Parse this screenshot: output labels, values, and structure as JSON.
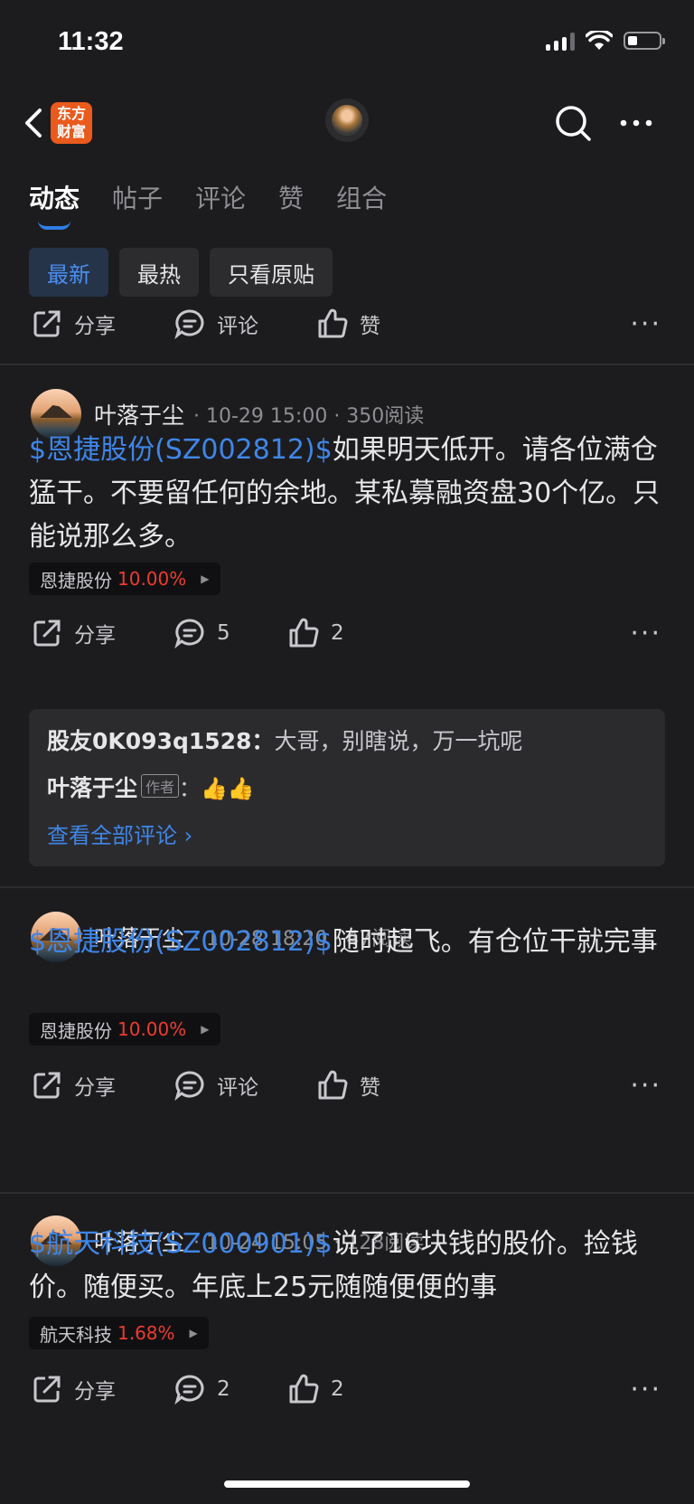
{
  "status": {
    "time": "11:32"
  },
  "nav": {
    "logo_line1": "东方",
    "logo_line2": "财富"
  },
  "tabs": [
    "动态",
    "帖子",
    "评论",
    "赞",
    "组合"
  ],
  "filters": [
    "最新",
    "最热",
    "只看原贴"
  ],
  "labels": {
    "share": "分享",
    "comment": "评论",
    "like": "赞",
    "more": "···"
  },
  "posts": [
    {
      "author": "叶落于尘",
      "meta": "· 10-29 15:00 · 350阅读",
      "tag": "$恩捷股份(SZ002812)$",
      "text": "如果明天低开。请各位满仓猛干。不要留任何的余地。某私募融资盘30个亿。只能说那么多。",
      "stock": "恩捷股份",
      "pct": "10.00%",
      "comment_count": "5",
      "like_count": "2"
    },
    {
      "author": "叶落于尘",
      "meta": "· 10-28 18:20 · 47阅读",
      "tag": "$恩捷股份(SZ002812)$",
      "text": "随时起飞。有仓位干就完事",
      "stock": "恩捷股份",
      "pct": "10.00%",
      "comment_count": "评论",
      "like_count": "赞"
    },
    {
      "author": "叶落于尘",
      "meta": "· 10-24 15:05 · 128阅读",
      "tag": "$航天科技(SZ000901)$",
      "text": "说了16块钱的股价。捡钱价。随便买。年底上25元随随便便的事",
      "stock": "航天科技",
      "pct": "1.68%",
      "comment_count": "2",
      "like_count": "2"
    }
  ],
  "comments": {
    "c1_user": "股友0K093q1528：",
    "c1_text": "大哥，别瞎说，万一坑呢",
    "c2_user": "叶落于尘",
    "c2_badge": "作者",
    "c2_text": "：👍👍",
    "view_all": "查看全部评论 ›"
  }
}
